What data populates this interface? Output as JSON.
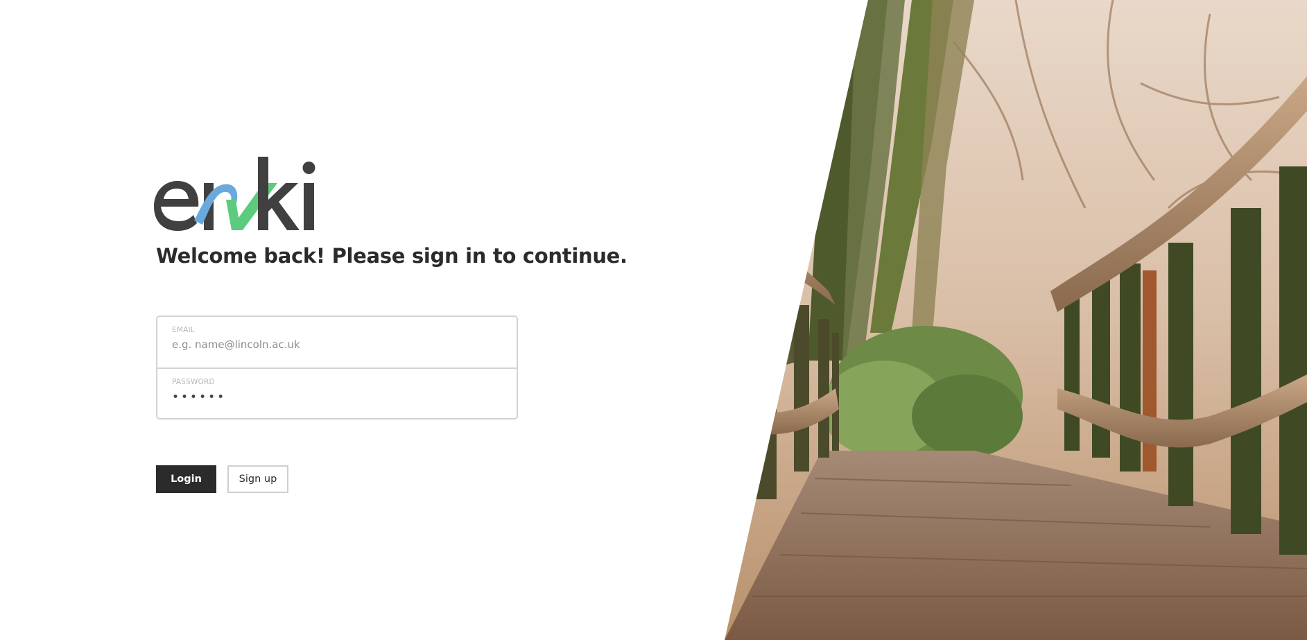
{
  "brand": {
    "logo_text": "enki",
    "colors": {
      "dark": "#404040",
      "blue": "#6aa9dc",
      "green": "#5ccb7d"
    }
  },
  "headline": "Welcome back! Please sign in to continue.",
  "form": {
    "email": {
      "label": "EMAIL",
      "placeholder": "e.g. name@lincoln.ac.uk",
      "value": ""
    },
    "password": {
      "label": "PASSWORD",
      "masked_value": "••••••"
    }
  },
  "buttons": {
    "login_label": "Login",
    "signup_label": "Sign up"
  },
  "hero_image": {
    "icon": "forest-boardwalk-photo"
  },
  "colors": {
    "text": "#2b2b2b",
    "border": "#d3d3d3",
    "primary_button": "#2b2b2b"
  }
}
